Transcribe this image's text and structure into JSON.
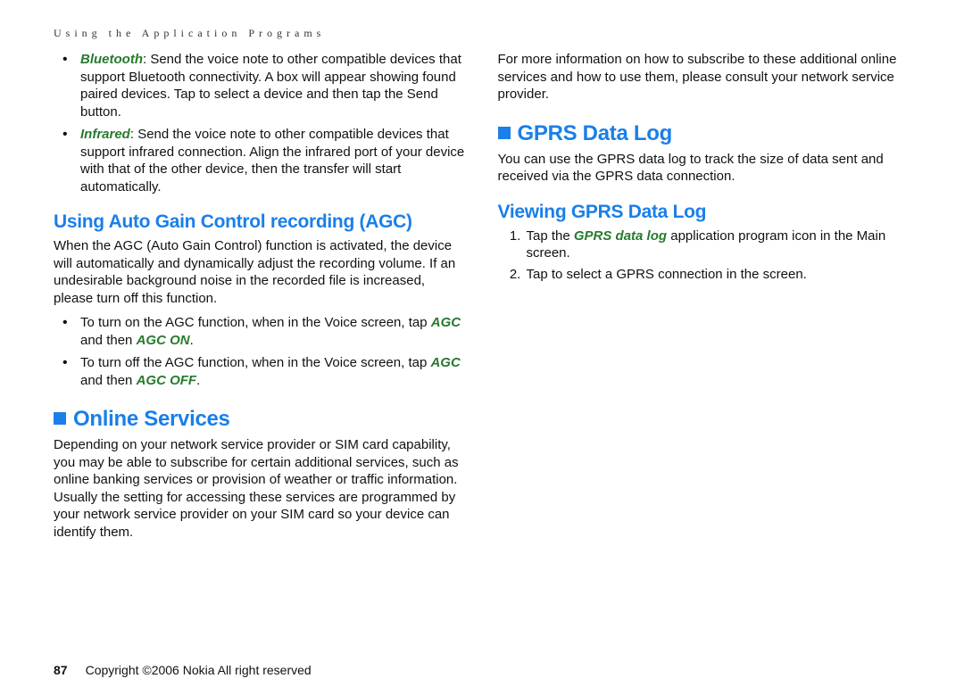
{
  "header": "Using the Application Programs",
  "left": {
    "bullets1": [
      {
        "term": "Bluetooth",
        "text": ": Send the voice note to other compatible devices that support Bluetooth connectivity. A box will appear showing found paired devices. Tap to select a device and then tap the Send button."
      },
      {
        "term": "Infrared",
        "text": ": Send the voice note to other compatible devices that support infrared connection. Align the infrared port of your device with that of the other device, then the transfer will start automatically."
      }
    ],
    "agc_heading": "Using Auto Gain Control recording (AGC)",
    "agc_para": "When the AGC (Auto Gain Control) function is activated, the device will automatically and dynamically adjust the recording volume. If an undesirable background noise in the recorded file is increased, please turn off this function.",
    "agc_bullets": [
      {
        "pre": "To turn on the AGC function, when in the Voice screen, tap ",
        "t1": "AGC",
        "mid": " and then ",
        "t2": "AGC ON",
        "post": "."
      },
      {
        "pre": "To turn off the AGC function, when in the Voice screen, tap ",
        "t1": "AGC",
        "mid": " and then ",
        "t2": "AGC OFF",
        "post": "."
      }
    ],
    "online_heading": "Online Services",
    "online_para": "Depending on your network service provider or SIM card capability, you may be able to subscribe for certain additional services, such as online banking services or provision of weather or traffic information. Usually the setting for accessing these services are programmed by your network service provider on your SIM card so your device can identify them."
  },
  "right": {
    "top_para": "For more information on how to subscribe to these additional online services and how to use them, please consult your network service provider.",
    "gprs_heading": "GPRS Data Log",
    "gprs_para": "You can use the GPRS data log to track the size of data sent and received via the GPRS data connection.",
    "viewing_heading": "Viewing GPRS Data Log",
    "steps": [
      {
        "pre": "Tap the ",
        "term": "GPRS data log",
        "post": " application program icon in the Main screen."
      },
      {
        "plain": "Tap to select a GPRS connection in the screen."
      }
    ]
  },
  "footer": {
    "page": "87",
    "copy": "Copyright ©2006 Nokia All right reserved"
  }
}
